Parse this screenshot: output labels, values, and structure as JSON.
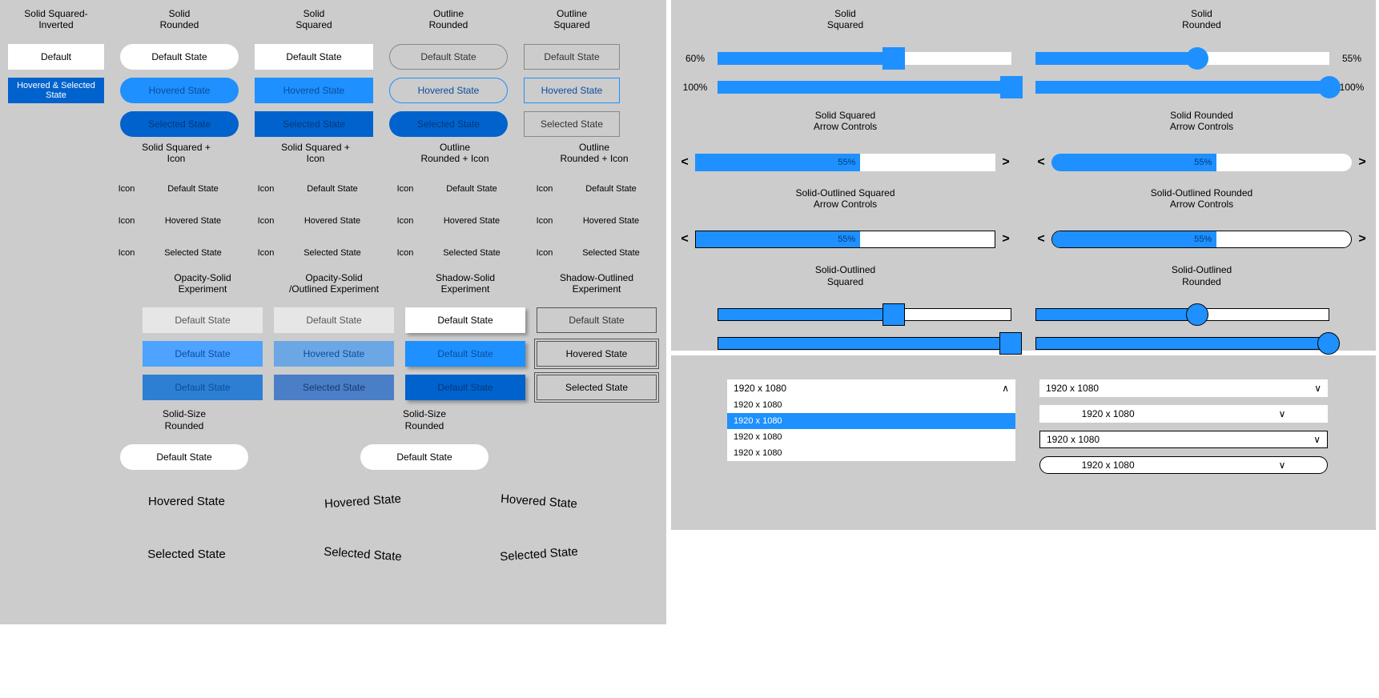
{
  "buttons": {
    "col1": {
      "title": "Solid Squared-\nInverted",
      "b1": "Default",
      "b2": "Hovered & Selected State"
    },
    "col2": {
      "title": "Solid\nRounded",
      "b1": "Default State",
      "b2": "Hovered State",
      "b3": "Selected State"
    },
    "col3": {
      "title": "Solid\nSquared",
      "b1": "Default State",
      "b2": "Hovered State",
      "b3": "Selected State"
    },
    "col4": {
      "title": "Outline\nRounded",
      "b1": "Default State",
      "b2": "Hovered State",
      "b3": "Selected State"
    },
    "col5": {
      "title": "Outline\nSquared",
      "b1": "Default State",
      "b2": "Hovered State",
      "b3": "Selected State"
    }
  },
  "iconbtns": {
    "icon": "Icon",
    "c1": {
      "title": "Solid Squared +\nIcon",
      "b1": "Default State",
      "b2": "Hovered State",
      "b3": "Selected State"
    },
    "c2": {
      "title": "Solid Squared +\nIcon",
      "b1": "Default State",
      "b2": "Hovered State",
      "b3": "Selected State"
    },
    "c3": {
      "title": "Outline\nRounded + Icon",
      "b1": "Default State",
      "b2": "Hovered State",
      "b3": "Selected State"
    },
    "c4": {
      "title": "Outline\nRounded + Icon",
      "b1": "Default State",
      "b2": "Hovered State",
      "b3": "Selected State"
    }
  },
  "experiments": {
    "c1": {
      "title": "Opacity-Solid\nExperiment",
      "b1": "Default State",
      "b2": "Default State",
      "b3": "Default State"
    },
    "c2": {
      "title": "Opacity-Solid\n/Outlined Experiment",
      "b1": "Default State",
      "b2": "Hovered State",
      "b3": "Selected State"
    },
    "c3": {
      "title": "Shadow-Solid\nExperiment",
      "b1": "Default State",
      "b2": "Default State",
      "b3": "Default State"
    },
    "c4": {
      "title": "Shadow-Outlined\nExperiment",
      "b1": "Default State",
      "b2": "Hovered State",
      "b3": "Selected State"
    }
  },
  "sizes": {
    "c1": {
      "title": "Solid-Size\nRounded",
      "def": "Default State",
      "hov": "Hovered State",
      "sel": "Selected State"
    },
    "c2": {
      "title": "Solid-Size\nRounded",
      "def": "Default State",
      "hov": "Hovered State",
      "sel": "Selected State"
    },
    "c3hov": "Hovered State",
    "c3sel": "Selected State"
  },
  "sliders": {
    "s1": {
      "title": "Solid\nSquared",
      "v1": "60%",
      "v2": "100%"
    },
    "s2": {
      "title": "Solid\nRounded",
      "v1": "55%",
      "v2": "100%"
    },
    "a1": {
      "title": "Solid Squared\nArrow Controls",
      "v": "55%"
    },
    "a2": {
      "title": "Solid Rounded\nArrow Controls",
      "v": "55%"
    },
    "a3": {
      "title": "Solid-Outlined Squared\nArrow Controls",
      "v": "55%"
    },
    "a4": {
      "title": "Solid-Outlined Rounded\nArrow Controls",
      "v": "55%"
    },
    "o1": {
      "title": "Solid-Outlined\nSquared"
    },
    "o2": {
      "title": "Solid-Outlined\nRounded"
    },
    "lt": "<",
    "gt": ">"
  },
  "dropdowns": {
    "value": "1920 x 1080",
    "opts": [
      "1920 x 1080",
      "1920 x 1080",
      "1920 x 1080",
      "1920 x 1080"
    ],
    "up": "∧",
    "down": "∨"
  }
}
